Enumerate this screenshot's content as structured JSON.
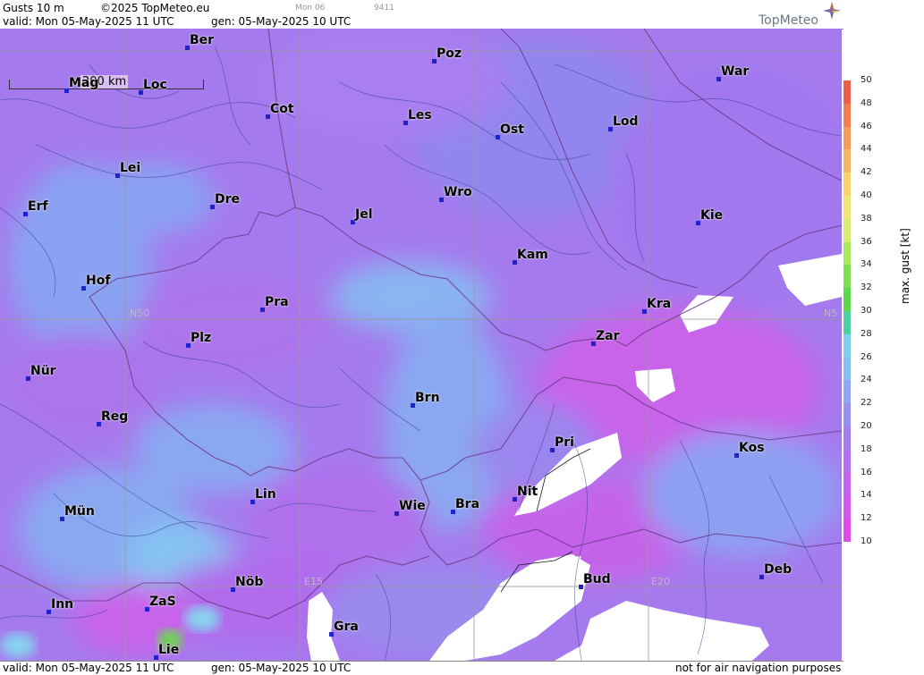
{
  "header": {
    "product": "Gusts 10 m",
    "copyright": "©2025 TopMeteo.eu",
    "small_day": "Mon 06",
    "small_code": "9411",
    "valid": "valid:  Mon  05-May-2025  11 UTC",
    "gen": "gen: 05-May-2025 10 UTC",
    "logo": "TopMeteo"
  },
  "footer": {
    "valid": "valid:  Mon  05-May-2025  11 UTC",
    "gen": "gen: 05-May-2025 10 UTC",
    "note": "not for air navigation purposes"
  },
  "scale_bar": {
    "label": "200 km"
  },
  "grid_labels": {
    "n50_left": "N50",
    "n50_right": "N5",
    "e15": "E15",
    "e20": "E20"
  },
  "cities": [
    {
      "name": "Ber"
    },
    {
      "name": "Poz"
    },
    {
      "name": "War"
    },
    {
      "name": "Mag"
    },
    {
      "name": "Loc"
    },
    {
      "name": "Cot"
    },
    {
      "name": "Les"
    },
    {
      "name": "Ost"
    },
    {
      "name": "Lod"
    },
    {
      "name": "Lei"
    },
    {
      "name": "Dre"
    },
    {
      "name": "Wro"
    },
    {
      "name": "Erf"
    },
    {
      "name": "Jel"
    },
    {
      "name": "Kie"
    },
    {
      "name": "Kam"
    },
    {
      "name": "Hof"
    },
    {
      "name": "Pra"
    },
    {
      "name": "Kra"
    },
    {
      "name": "Plz"
    },
    {
      "name": "Zar"
    },
    {
      "name": "Nür"
    },
    {
      "name": "Brn"
    },
    {
      "name": "Reg"
    },
    {
      "name": "Pri"
    },
    {
      "name": "Kos"
    },
    {
      "name": "Lin"
    },
    {
      "name": "Nit"
    },
    {
      "name": "Mün"
    },
    {
      "name": "Wie"
    },
    {
      "name": "Bra"
    },
    {
      "name": "Deb"
    },
    {
      "name": "Nöb"
    },
    {
      "name": "Bud"
    },
    {
      "name": "Inn"
    },
    {
      "name": "ZaS"
    },
    {
      "name": "Gra"
    },
    {
      "name": "Lie"
    }
  ],
  "colorbar": {
    "unit_label": "max. gust [kt]",
    "ticks": [
      "50",
      "48",
      "46",
      "44",
      "42",
      "40",
      "38",
      "36",
      "34",
      "32",
      "30",
      "28",
      "26",
      "24",
      "22",
      "20",
      "18",
      "16",
      "14",
      "12",
      "10"
    ],
    "colors": [
      "#e8604a",
      "#f07e52",
      "#f59a5a",
      "#f7b864",
      "#f7d46c",
      "#f2e672",
      "#d8ee6e",
      "#a8e85c",
      "#7ee04e",
      "#5cd84c",
      "#4cd0a0",
      "#7ad2ee",
      "#86c0f2",
      "#8ea8f4",
      "#9690f0",
      "#a27ef0",
      "#b470ee",
      "#c464ec",
      "#d058ea",
      "#dc4ce8"
    ]
  }
}
